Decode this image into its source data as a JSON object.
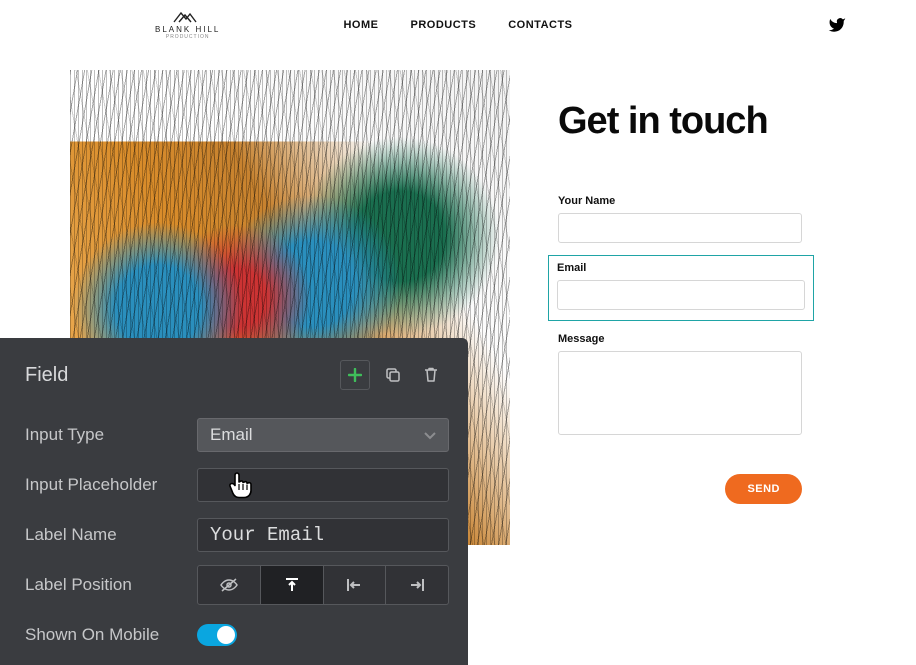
{
  "header": {
    "logo_text": "BLANK HILL",
    "logo_sub": "PRODUCTION",
    "nav": {
      "home": "HOME",
      "products": "PRODUCTS",
      "contacts": "CONTACTS"
    }
  },
  "contact": {
    "title": "Get in touch",
    "name_label": "Your Name",
    "name_value": "",
    "email_label": "Email",
    "email_value": "",
    "message_label": "Message",
    "message_value": "",
    "send_label": "SEND"
  },
  "panel": {
    "title": "Field",
    "rows": {
      "input_type": {
        "label": "Input Type",
        "value": "Email"
      },
      "placeholder": {
        "label": "Input Placeholder",
        "value": ""
      },
      "label_name": {
        "label": "Label Name",
        "value": "Your Email"
      },
      "label_position": {
        "label": "Label Position"
      },
      "shown_mobile": {
        "label": "Shown On Mobile",
        "value": true
      }
    }
  }
}
